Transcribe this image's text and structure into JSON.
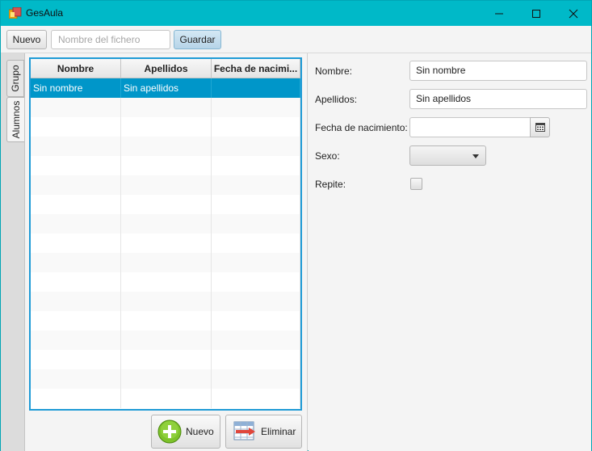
{
  "window": {
    "title": "GesAula",
    "icon": "app-icon",
    "controls": [
      "minimize-icon",
      "maximize-icon",
      "close-icon"
    ]
  },
  "toolbar": {
    "new_label": "Nuevo",
    "filename_placeholder": "Nombre del fichero",
    "filename_value": "",
    "save_label": "Guardar"
  },
  "tabs": [
    {
      "label": "Grupo",
      "selected": false
    },
    {
      "label": "Alumnos",
      "selected": true
    }
  ],
  "table": {
    "columns": [
      "Nombre",
      "Apellidos",
      "Fecha de nacimi..."
    ],
    "rows": [
      {
        "nombre": "Sin nombre",
        "apellidos": "Sin apellidos",
        "fecha": "",
        "selected": true
      }
    ],
    "selection_color": "#0096c9",
    "border_color": "#1f9bd6"
  },
  "actions": {
    "add_label": "Nuevo",
    "add_icon": "plus-circle-icon",
    "delete_label": "Eliminar",
    "delete_icon": "table-delete-icon"
  },
  "form": {
    "name_label": "Nombre:",
    "name_value": "Sin nombre",
    "surname_label": "Apellidos:",
    "surname_value": "Sin apellidos",
    "birthdate_label": "Fecha de nacimiento:",
    "birthdate_value": "",
    "birthdate_icon": "calendar-icon",
    "sex_label": "Sexo:",
    "sex_value": "",
    "repeat_label": "Repite:",
    "repeat_checked": false
  },
  "colors": {
    "titlebar": "#00b9c8",
    "accent": "#0096c9"
  }
}
